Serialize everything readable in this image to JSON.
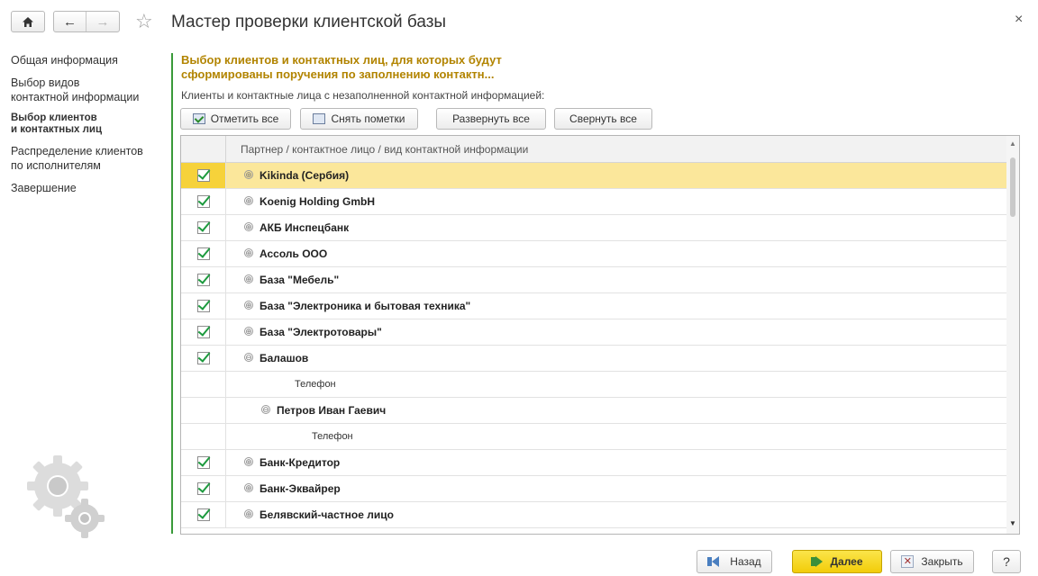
{
  "header": {
    "title": "Мастер проверки клиентской базы",
    "home_icon": "home-icon",
    "back_icon": "←",
    "forward_icon": "→",
    "star_icon": "☆",
    "close_icon": "×"
  },
  "sidebar": {
    "items": [
      {
        "label": "Общая информация",
        "active": false
      },
      {
        "label": "Выбор видов\nконтактной информации",
        "active": false
      },
      {
        "label": "Выбор клиентов\nи контактных лиц",
        "active": true
      },
      {
        "label": "Распределение клиентов\nпо исполнителям",
        "active": false
      },
      {
        "label": "Завершение",
        "active": false
      }
    ]
  },
  "main": {
    "heading": "Выбор клиентов и контактных лиц, для которых будут\nсформированы поручения по заполнению контактн...",
    "subheading": "Клиенты и контактные лица с незаполненной контактной информацией:",
    "accent_color": "#b28400",
    "toolbar": {
      "mark_all": "Отметить все",
      "unmark": "Снять пометки",
      "expand_all": "Развернуть все",
      "collapse_all": "Свернуть все"
    },
    "table": {
      "column_header": "Партнер / контактное лицо / вид контактной информации",
      "rows": [
        {
          "label": "Kikinda (Сербия)",
          "checked": true,
          "level": 0,
          "expander": "⊕",
          "bold": true,
          "selected": true
        },
        {
          "label": "Koenig Holding GmbH",
          "checked": true,
          "level": 0,
          "expander": "⊕",
          "bold": true
        },
        {
          "label": "АКБ Инспецбанк",
          "checked": true,
          "level": 0,
          "expander": "⊕",
          "bold": true
        },
        {
          "label": "Ассоль ООО",
          "checked": true,
          "level": 0,
          "expander": "⊕",
          "bold": true
        },
        {
          "label": "База \"Мебель\"",
          "checked": true,
          "level": 0,
          "expander": "⊕",
          "bold": true
        },
        {
          "label": "База \"Электроника и бытовая техника\"",
          "checked": true,
          "level": 0,
          "expander": "⊕",
          "bold": true
        },
        {
          "label": "База \"Электротовары\"",
          "checked": true,
          "level": 0,
          "expander": "⊕",
          "bold": true
        },
        {
          "label": "Балашов",
          "checked": true,
          "level": 0,
          "expander": "⊖",
          "bold": true
        },
        {
          "label": "Телефон",
          "checked": false,
          "level": 1,
          "expander": "",
          "bold": false
        },
        {
          "label": "Петров Иван Гаевич",
          "checked": false,
          "level": 1,
          "expander": "⊖",
          "bold": true
        },
        {
          "label": "Телефон",
          "checked": false,
          "level": 2,
          "expander": "",
          "bold": false
        },
        {
          "label": "Банк-Кредитор",
          "checked": true,
          "level": 0,
          "expander": "⊕",
          "bold": true
        },
        {
          "label": "Банк-Эквайрер",
          "checked": true,
          "level": 0,
          "expander": "⊕",
          "bold": true
        },
        {
          "label": "Белявский-частное лицо",
          "checked": true,
          "level": 0,
          "expander": "⊕",
          "bold": true
        }
      ]
    }
  },
  "footer": {
    "back": "Назад",
    "next": "Далее",
    "close": "Закрыть",
    "help": "?"
  }
}
